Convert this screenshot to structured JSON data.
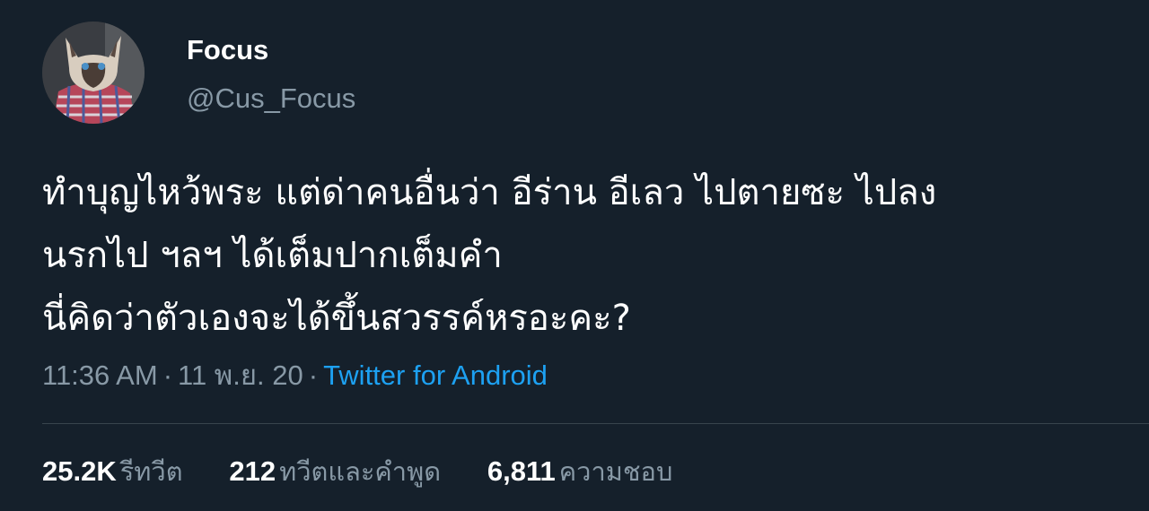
{
  "user": {
    "display_name": "Focus",
    "handle": "@Cus_Focus",
    "avatar_icon": "cat-avatar-icon"
  },
  "tweet": {
    "lines": [
      "ทำบุญไหว้พระ แต่ด่าคนอื่นว่า อีร่าน อีเลว ไปตายซะ ไปลง",
      "นรกไป ฯลฯ ได้เต็มปากเต็มคำ",
      "นี่คิดว่าตัวเองจะได้ขึ้นสวรรค์หรอะคะ?"
    ]
  },
  "meta": {
    "time": "11:36 AM",
    "date": "11 พ.ย. 20",
    "separator": "·",
    "source": "Twitter for Android"
  },
  "stats": {
    "retweets_count": "25.2K",
    "retweets_label": "รีทวีต",
    "quotes_count": "212",
    "quotes_label": "ทวีตและคำพูด",
    "likes_count": "6,811",
    "likes_label": "ความชอบ"
  },
  "colors": {
    "background": "#15202b",
    "primary_text": "#ffffff",
    "secondary_text": "#8899a6",
    "link": "#1da1f2",
    "divider": "#38444d"
  }
}
